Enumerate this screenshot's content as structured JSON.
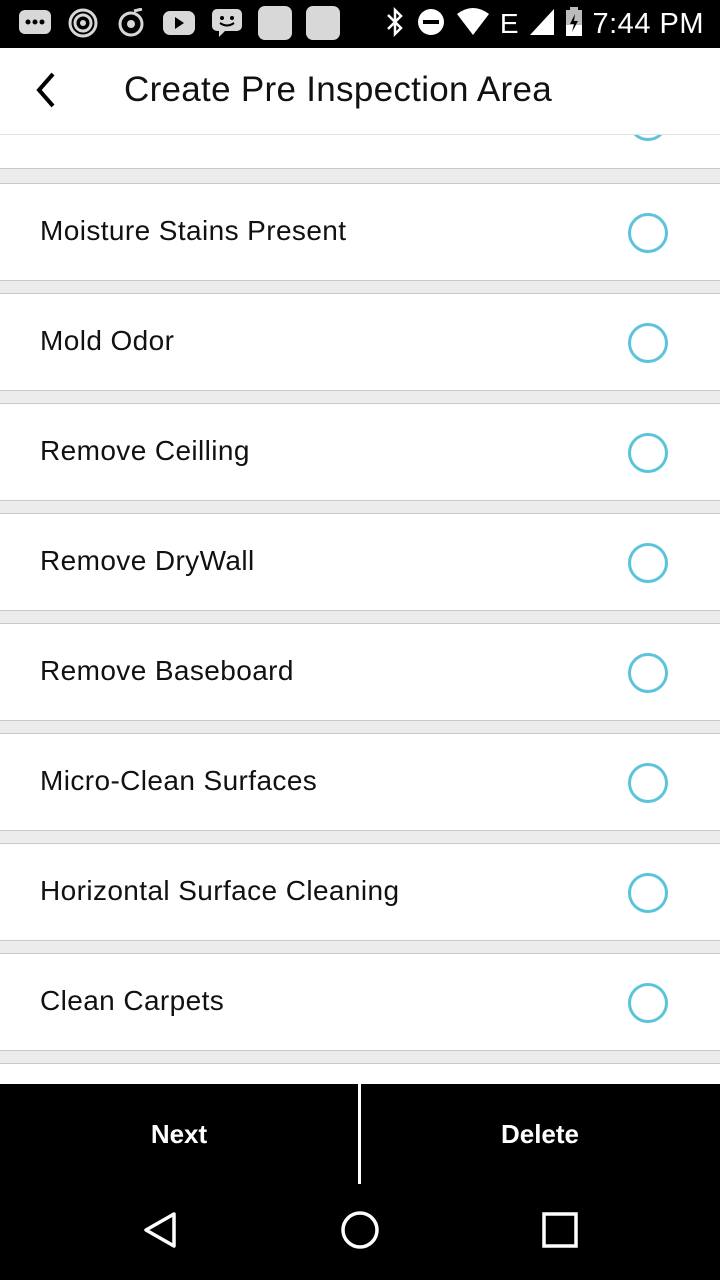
{
  "status_bar": {
    "time": "7:44 PM",
    "network_label": "E",
    "left_icons": [
      "chat-bubble-icon",
      "signal-rings-icon",
      "camera-aperture-icon",
      "youtube-icon",
      "messenger-icon",
      "app-placeholder-icon",
      "app-placeholder-icon"
    ],
    "right_icons": [
      "bluetooth-icon",
      "do-not-disturb-icon",
      "wifi-icon",
      "cell-signal-icon",
      "battery-charging-icon"
    ]
  },
  "app_bar": {
    "title": "Create Pre Inspection Area",
    "back_icon": "chevron-left-icon"
  },
  "list": {
    "items": [
      {
        "label": ""
      },
      {
        "label": "Moisture Stains Present"
      },
      {
        "label": "Mold Odor"
      },
      {
        "label": "Remove Ceilling"
      },
      {
        "label": "Remove DryWall"
      },
      {
        "label": "Remove Baseboard"
      },
      {
        "label": "Micro-Clean Surfaces"
      },
      {
        "label": "Horizontal Surface Cleaning"
      },
      {
        "label": "Clean Carpets"
      },
      {
        "label": ""
      }
    ]
  },
  "actions": {
    "next_label": "Next",
    "delete_label": "Delete"
  },
  "nav": {
    "back_icon": "triangle-back-icon",
    "home_icon": "circle-home-icon",
    "recents_icon": "square-recents-icon"
  },
  "colors": {
    "accent": "#5bc4dc",
    "bar_background": "#000000",
    "list_background": "#ececec"
  }
}
